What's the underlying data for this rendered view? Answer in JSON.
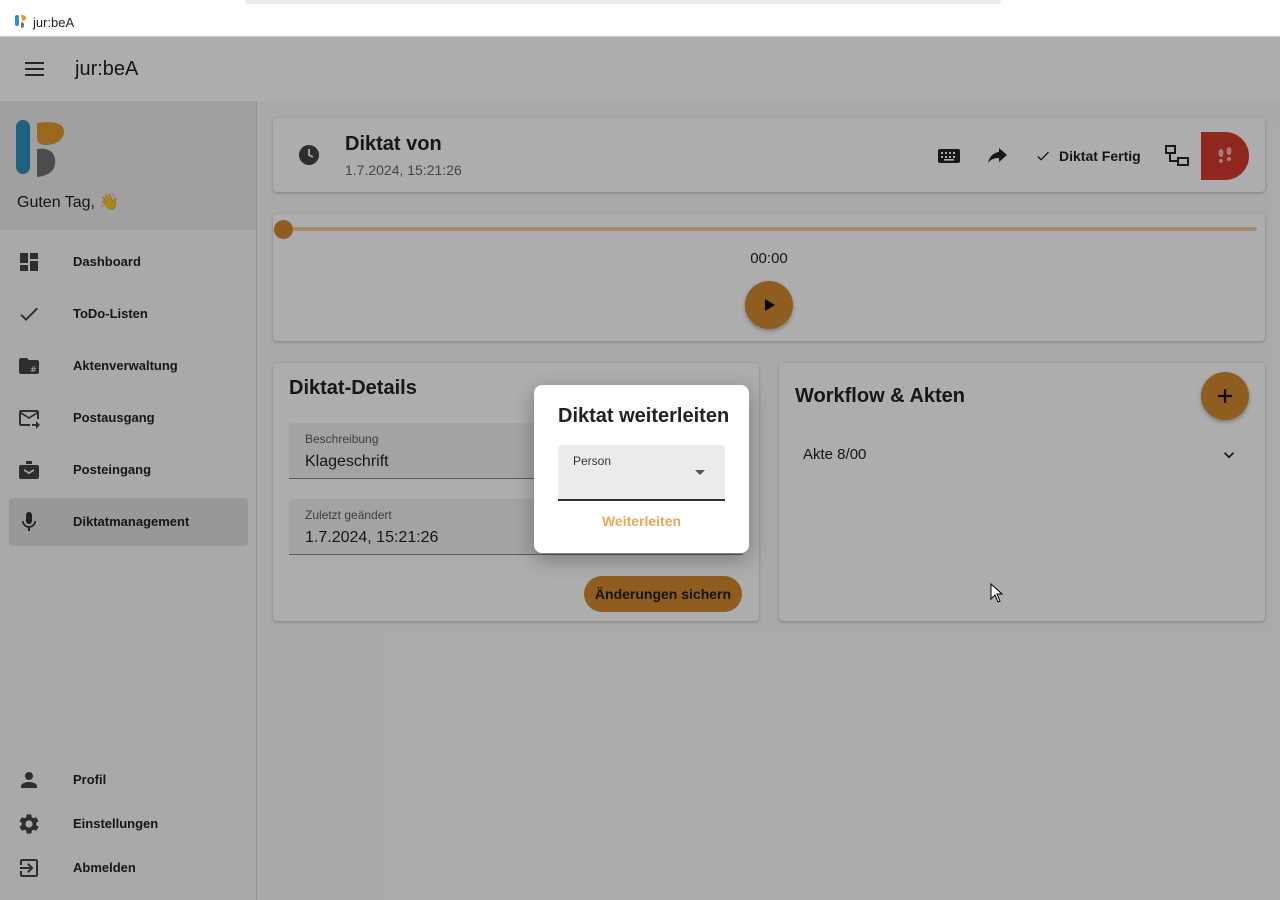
{
  "window": {
    "title": "jur:beA"
  },
  "appbar": {
    "title": "jur:beA"
  },
  "sidebar": {
    "greeting": "Guten Tag, 👋",
    "items": [
      {
        "label": "Dashboard",
        "icon": "dashboard-icon"
      },
      {
        "label": "ToDo-Listen",
        "icon": "check-icon"
      },
      {
        "label": "Aktenverwaltung",
        "icon": "folder-hash-icon"
      },
      {
        "label": "Postausgang",
        "icon": "outbox-mail-icon"
      },
      {
        "label": "Posteingang",
        "icon": "inbox-icon"
      },
      {
        "label": "Diktatmanagement",
        "icon": "microphone-icon",
        "active": true
      }
    ],
    "bottom_items": [
      {
        "label": "Profil",
        "icon": "person-icon"
      },
      {
        "label": "Einstellungen",
        "icon": "gear-icon"
      },
      {
        "label": "Abmelden",
        "icon": "logout-icon"
      }
    ]
  },
  "header": {
    "title": "Diktat von",
    "subtitle": "1.7.2024, 15:21:26",
    "done_label": "Diktat Fertig"
  },
  "player": {
    "time": "00:00",
    "progress": 0
  },
  "details": {
    "title": "Diktat-Details",
    "description_label": "Beschreibung",
    "description_value": "Klageschrift",
    "modified_label": "Zuletzt geändert",
    "modified_value": "1.7.2024, 15:21:26",
    "save_label": "Änderungen sichern"
  },
  "workflow": {
    "title": "Workflow & Akten",
    "akte_label": "Akte 8/00"
  },
  "dialog": {
    "title": "Diktat weiterleiten",
    "person_label": "Person",
    "person_value": "",
    "forward_label": "Weiterleiten"
  },
  "colors": {
    "accent": "#d28a2e",
    "record": "#d43a2f",
    "forward_text": "#e8a855"
  }
}
